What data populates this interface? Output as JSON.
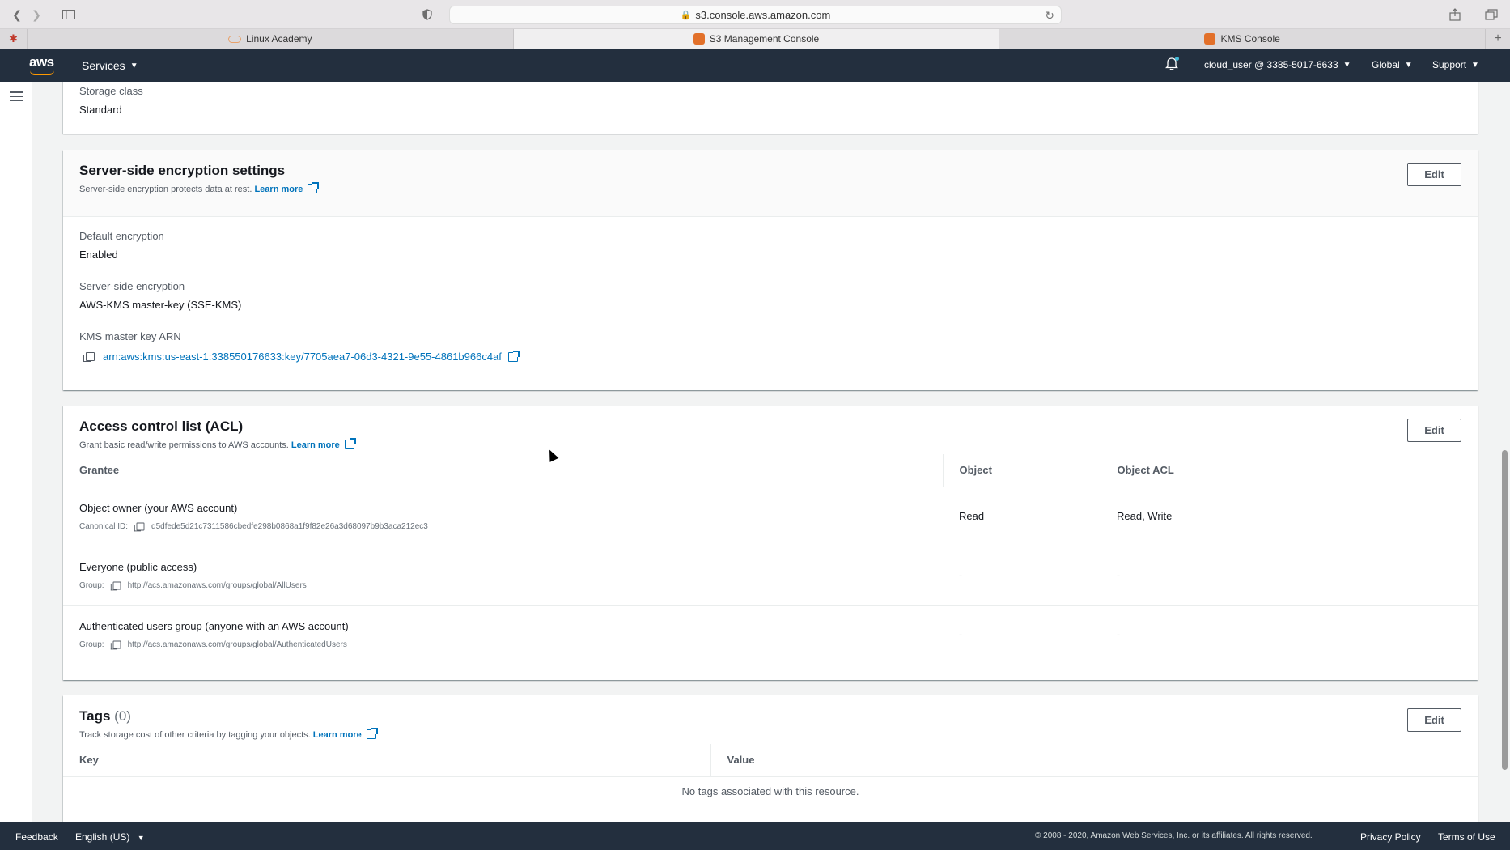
{
  "browser": {
    "url": "s3.console.aws.amazon.com",
    "tabs": [
      {
        "label": "Linux Academy"
      },
      {
        "label": "S3 Management Console"
      },
      {
        "label": "KMS Console"
      }
    ]
  },
  "nav": {
    "logo": "aws",
    "services": "Services",
    "user": "cloud_user @ 3385-5017-6633",
    "region": "Global",
    "support": "Support"
  },
  "storage": {
    "label": "Storage class",
    "value": "Standard"
  },
  "sse": {
    "title": "Server-side encryption settings",
    "desc": "Server-side encryption protects data at rest.",
    "learn_more": "Learn more",
    "edit": "Edit",
    "default_enc_label": "Default encryption",
    "default_enc_value": "Enabled",
    "sse_label": "Server-side encryption",
    "sse_value": "AWS-KMS master-key (SSE-KMS)",
    "arn_label": "KMS master key ARN",
    "arn_value": "arn:aws:kms:us-east-1:338550176633:key/7705aea7-06d3-4321-9e55-4861b966c4af"
  },
  "acl": {
    "title": "Access control list (ACL)",
    "desc": "Grant basic read/write permissions to AWS accounts.",
    "learn_more": "Learn more",
    "edit": "Edit",
    "columns": [
      "Grantee",
      "Object",
      "Object ACL"
    ],
    "rows": [
      {
        "name": "Object owner (your AWS account)",
        "sub_label": "Canonical ID:",
        "sub_value": "d5dfede5d21c7311586cbedfe298b0868a1f9f82e26a3d68097b9b3aca212ec3",
        "object": "Read",
        "object_acl": "Read, Write"
      },
      {
        "name": "Everyone (public access)",
        "sub_label": "Group:",
        "sub_value": "http://acs.amazonaws.com/groups/global/AllUsers",
        "object": "-",
        "object_acl": "-"
      },
      {
        "name": "Authenticated users group (anyone with an AWS account)",
        "sub_label": "Group:",
        "sub_value": "http://acs.amazonaws.com/groups/global/AuthenticatedUsers",
        "object": "-",
        "object_acl": "-"
      }
    ]
  },
  "tags": {
    "title": "Tags",
    "count": "(0)",
    "desc": "Track storage cost of other criteria by tagging your objects.",
    "learn_more": "Learn more",
    "edit": "Edit",
    "columns": [
      "Key",
      "Value"
    ],
    "empty": "No tags associated with this resource."
  },
  "footer": {
    "feedback": "Feedback",
    "language": "English (US)",
    "copyright": "© 2008 - 2020, Amazon Web Services, Inc. or its affiliates. All rights reserved.",
    "privacy": "Privacy Policy",
    "terms": "Terms of Use"
  }
}
